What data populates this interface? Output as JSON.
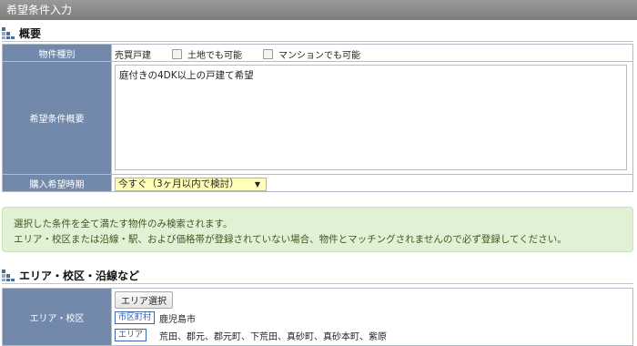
{
  "titlebar": {
    "title": "希望条件入力"
  },
  "overview": {
    "heading": "概要",
    "property_type": {
      "label": "物件種別",
      "value": "売買戸建",
      "options": [
        {
          "label": "土地でも可能",
          "checked": false
        },
        {
          "label": "マンションでも可能",
          "checked": false
        }
      ]
    },
    "summary": {
      "label": "希望条件概要",
      "value": "庭付きの4DK以上の戸建て希望"
    },
    "timing": {
      "label": "購入希望時期",
      "selected": "今すぐ（3ヶ月以内で検討）"
    }
  },
  "notice": {
    "line1": "選択した条件を全て満たす物件のみ検索されます。",
    "line2": "エリア・校区または沿線・駅、および価格帯が登録されていない場合、物件とマッチングされませんので必ず登録してください。"
  },
  "area": {
    "heading": "エリア・校区・沿線など",
    "label": "エリア・校区",
    "select_button": "エリア選択",
    "city_tag": "市区町村",
    "city_value": "鹿児島市",
    "area_tag": "エリア",
    "area_value": "荒田、郡元、郡元町、下荒田、真砂町、真砂本町、紫原"
  },
  "colors": {
    "label_bg": "#7389ac",
    "notice_bg": "#e1f1d6",
    "select_bg": "#ffffb8"
  }
}
